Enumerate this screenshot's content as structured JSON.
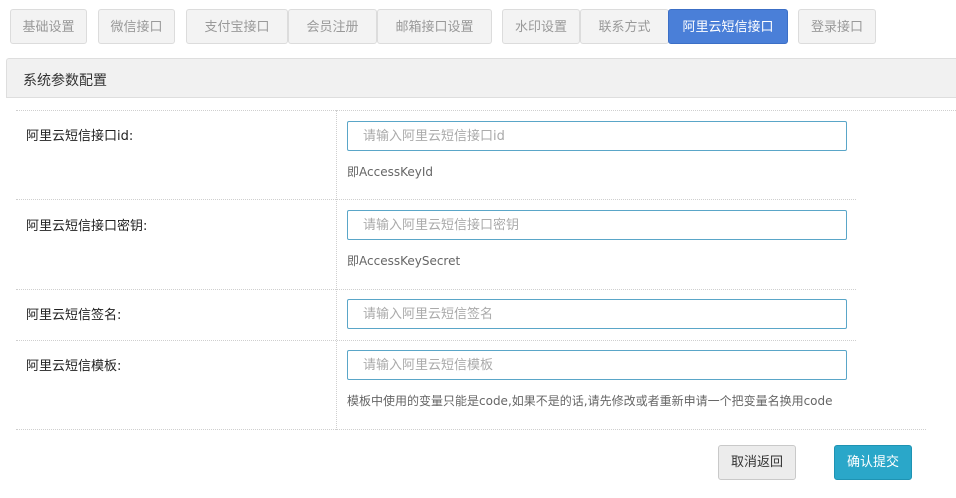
{
  "tabs": [
    {
      "label": "基础设置",
      "active": false
    },
    {
      "label": "微信接口",
      "active": false
    },
    {
      "label": "支付宝接口",
      "active": false
    },
    {
      "label": "会员注册",
      "active": false
    },
    {
      "label": "邮箱接口设置",
      "active": false
    },
    {
      "label": "水印设置",
      "active": false
    },
    {
      "label": "联系方式",
      "active": false
    },
    {
      "label": "阿里云短信接口",
      "active": true
    },
    {
      "label": "登录接口",
      "active": false
    }
  ],
  "panel": {
    "title": "系统参数配置"
  },
  "form": {
    "fields": [
      {
        "label": "阿里云短信接口id:",
        "placeholder": "请输入阿里云短信接口id",
        "value": "",
        "help": "即AccessKeyId"
      },
      {
        "label": "阿里云短信接口密钥:",
        "placeholder": "请输入阿里云短信接口密钥",
        "value": "",
        "help": "即AccessKeySecret"
      },
      {
        "label": "阿里云短信签名:",
        "placeholder": "请输入阿里云短信签名",
        "value": ""
      },
      {
        "label": "阿里云短信模板:",
        "placeholder": "请输入阿里云短信模板",
        "value": "",
        "help": "模板中使用的变量只能是code,如果不是的话,请先修改或者重新申请一个把变量名换用code"
      }
    ]
  },
  "actions": {
    "cancel_label": "取消返回",
    "submit_label": "确认提交"
  },
  "colors": {
    "active_tab": "#4a7fd8",
    "submit": "#2aa7c9",
    "input_border": "#5aa6c8"
  }
}
